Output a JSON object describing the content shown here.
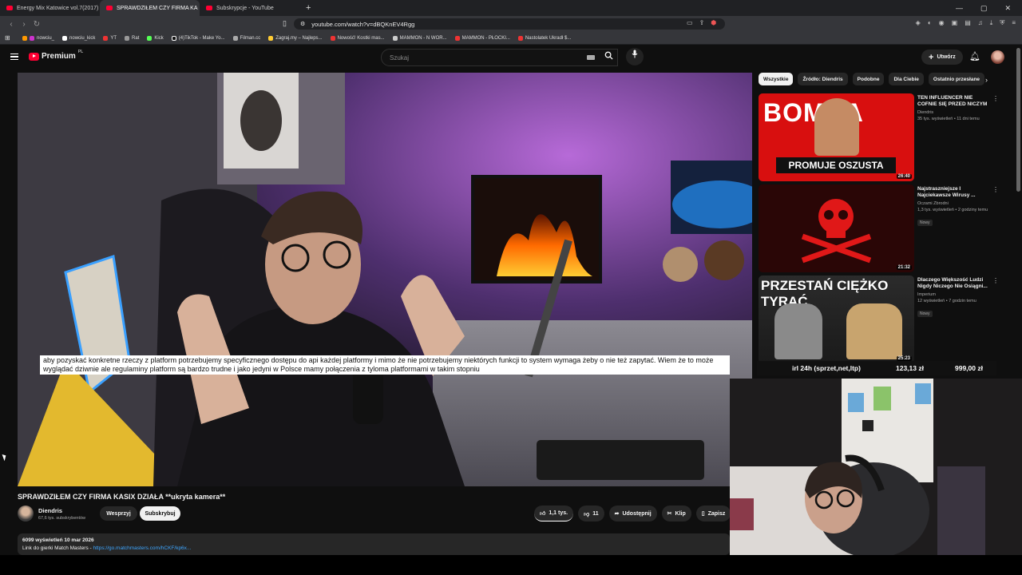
{
  "browser": {
    "tabs": [
      {
        "label": "Energy Mix Katowice vol.7(2017)",
        "active": false
      },
      {
        "label": "SPRAWDZIŁEM CZY FIRMA KA",
        "active": true
      },
      {
        "label": "Subskrypcje - YouTube",
        "active": false
      }
    ],
    "new_tab": "+",
    "url": "youtube.com/watch?v=dBQKnEV4Rgg",
    "bookmarks": [
      "nowciu_",
      "nowciu_kick",
      "YT",
      "Rat",
      "Kick",
      "(4)TikTok - Make Yo...",
      "Filman.cc",
      "Zagraj.my – Najleps...",
      "Nowość! Kostki mas...",
      "MAMMON - N WOR...",
      "MAMMON - PŁOCKI...",
      "Nastolatek Ukradł $..."
    ]
  },
  "header": {
    "logo": "Premium",
    "country": "PL",
    "search_placeholder": "Szukaj",
    "create_label": "Utwórz"
  },
  "video": {
    "caption": "aby pozyskać konkretne rzeczy z platform potrzebujemy specyficznego dostępu do api każdej platformy i mimo że nie potrzebujemy niektórych funkcji to system wymaga żeby o nie też zapytać. Wiem że to może wyglądać dziwnie ale regulaminy platform są bardzo trudne i jako jedyni w Polsce mamy połączenia z tyloma platformami w takim stopniu",
    "title": "SPRAWDZIŁEM CZY FIRMA KASIX DZIAŁA **ukryta kamera**",
    "channel": "Diendris",
    "subscribers": "67,6 tys. subskrybentów",
    "support_label": "Wesprzyj",
    "subscribe_label": "Subskrybuj",
    "likes": "1,1 tys.",
    "dislikes": "11",
    "share_label": "Udostępnij",
    "clip_label": "Klip",
    "save_label": "Zapisz",
    "views_date": "6099 wyświetleń  10 mar 2026",
    "desc_text": "Link do gierki Match Masters - ",
    "desc_link": "https://go.matchmasters.com/hCKF/kp6x..."
  },
  "chips": [
    "Wszystkie",
    "Źródło: Diendris",
    "Podobne",
    "Dla Ciebie",
    "Ostatnio przesłane"
  ],
  "recommendations": [
    {
      "title": "TEN INFLUENCER NIE COFNIE SIĘ PRZED NICZYM",
      "channel": "Diendris",
      "meta": "35 tys. wyświetleń • 11 dni temu",
      "duration": "26:40",
      "badge": "",
      "thumb_text_top": "BOMBA",
      "thumb_text_bottom": "PROMUJE OSZUSTA"
    },
    {
      "title": "Najstraszniejsze I Najciekawsze Wirusy ...",
      "channel": "Oczami Zbrodni",
      "meta": "1,3 tys. wyświetleń • 2 godziny temu",
      "duration": "21:32",
      "badge": "Nowy"
    },
    {
      "title": "Dlaczego Większość Ludzi Nigdy Niczego Nie Osiągni...",
      "channel": "Imperium",
      "meta": "12 wyświetleń • 7 godzin temu",
      "duration": "25:23",
      "badge": "Nowy",
      "thumb_text_top": "PRZESTAŃ CIĘŻKO TYRAĆ"
    }
  ],
  "overlay": {
    "label": "irl 24h (sprzet,net,ltp)",
    "current": "123,13 zł",
    "goal": "999,00 zł"
  },
  "colors": {
    "yt_red": "#ff0033",
    "bg": "#0f0f0f",
    "chip_bg": "#272727",
    "link": "#3ea6ff"
  }
}
